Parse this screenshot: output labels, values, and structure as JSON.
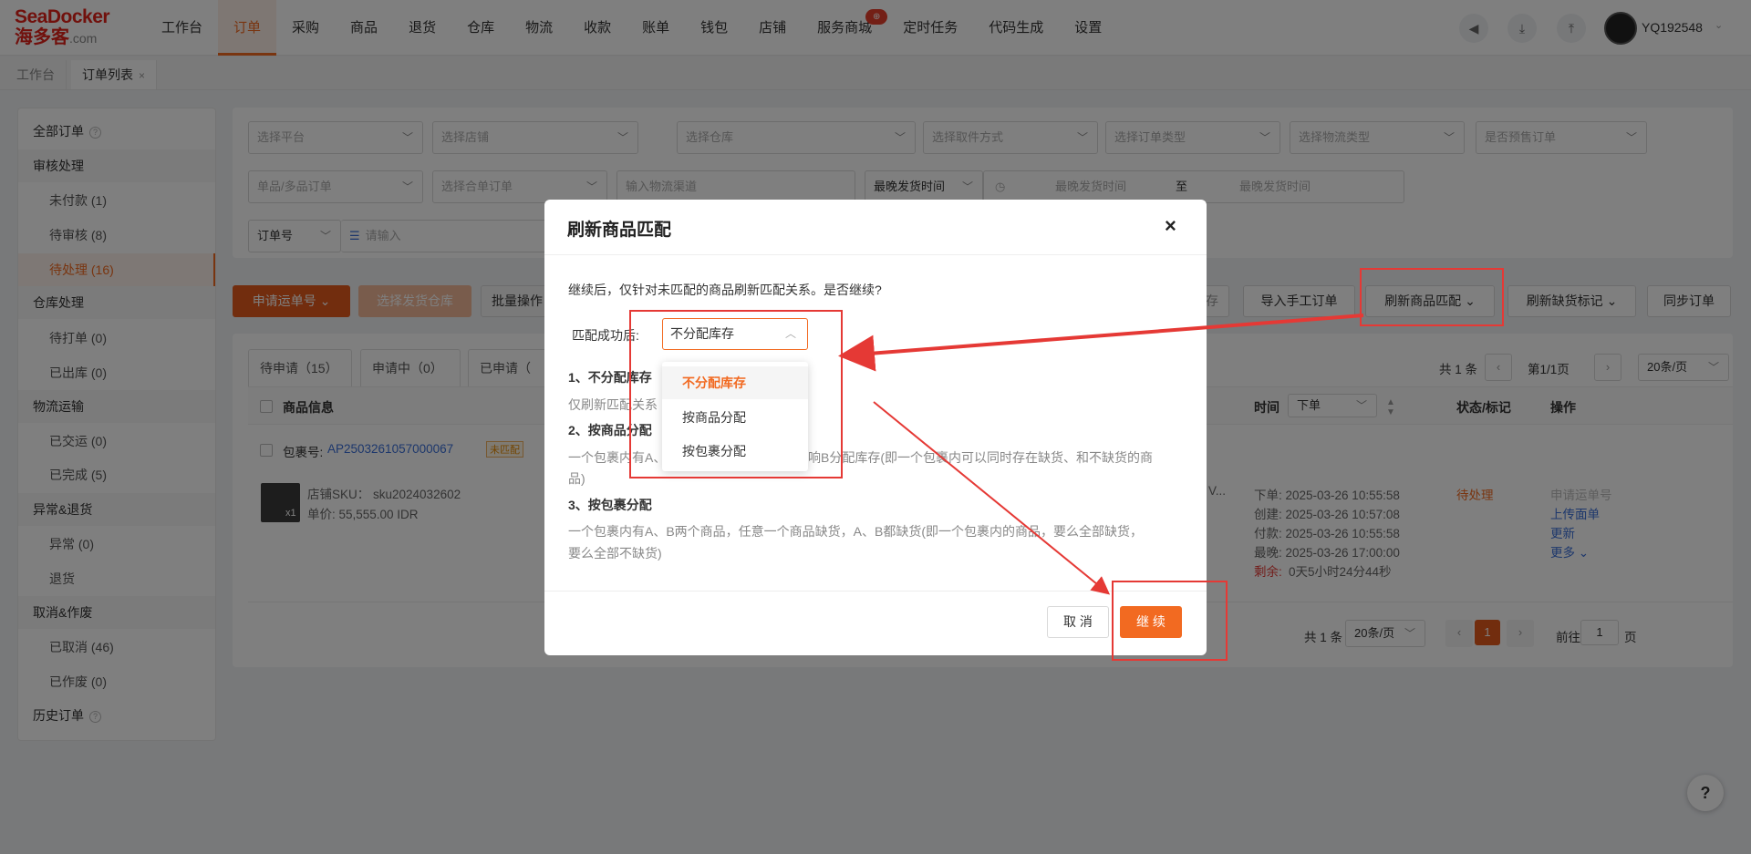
{
  "brand": {
    "line1": "SeaDocker",
    "line2": "海多客",
    "suffix": ".com"
  },
  "nav": [
    {
      "label": "工作台"
    },
    {
      "label": "订单",
      "active": true
    },
    {
      "label": "采购"
    },
    {
      "label": "商品"
    },
    {
      "label": "退货"
    },
    {
      "label": "仓库"
    },
    {
      "label": "物流"
    },
    {
      "label": "收款"
    },
    {
      "label": "账单"
    },
    {
      "label": "钱包"
    },
    {
      "label": "店铺"
    },
    {
      "label": "服务商城",
      "badge": "⊕"
    },
    {
      "label": "定时任务"
    },
    {
      "label": "代码生成"
    },
    {
      "label": "设置"
    }
  ],
  "user": {
    "name": "YQ192548",
    "chev": "⌄"
  },
  "tabs": [
    {
      "label": "工作台"
    },
    {
      "label": "订单列表",
      "close": "×"
    }
  ],
  "sidebar": {
    "all": "全部订单",
    "q": "?",
    "g1": "审核处理",
    "i1": "未付款 (1)",
    "i2": "待审核 (8)",
    "i3": "待处理 (16)",
    "g2": "仓库处理",
    "i4": "待打单 (0)",
    "i5": "已出库 (0)",
    "g3": "物流运输",
    "i6": "已交运 (0)",
    "i7": "已完成 (5)",
    "g4": "异常&退货",
    "i8": "异常 (0)",
    "i9": "退货",
    "g5": "取消&作废",
    "i10": "已取消 (46)",
    "i11": "已作废 (0)",
    "history": "历史订单"
  },
  "filters": {
    "platform": "选择平台",
    "shop": "选择店铺",
    "warehouse": "选择仓库",
    "pickup": "选择取件方式",
    "order_type": "选择订单类型",
    "logistics_type": "选择物流类型",
    "presale": "是否预售订单",
    "single_multi": "单品/多品订单",
    "merge": "选择合单订单",
    "channel": "输入物流渠道",
    "latest_ship": "最晚发货时间",
    "ship_start": "最晚发货时间",
    "to": "至",
    "ship_end": "最晚发货时间",
    "order_no": "订单号",
    "input_ph": "请输入"
  },
  "actions": {
    "apply": "申请运单号 ⌄",
    "select_wh": "选择发货仓库",
    "batch": "批量操作",
    "stock": "存",
    "import": "导入手工订单",
    "refresh_match": "刷新商品匹配 ⌄",
    "refresh_short": "刷新缺货标记 ⌄",
    "sync": "同步订单"
  },
  "status_tabs": [
    {
      "label": "待申请（15）"
    },
    {
      "label": "申请中（0）"
    },
    {
      "label": "已申请（"
    }
  ],
  "table": {
    "col_product": "商品信息",
    "col_time": "时间",
    "time_sel": "下单",
    "col_status": "状态/标记",
    "col_op": "操作",
    "pkg_label": "包裹号:",
    "pkg_no": "AP2503261057000067",
    "pkg_badge": "未匹配",
    "sku": "店铺SKU： sku2024032602",
    "price": "单价: 55,555.00 IDR",
    "qty": "x1",
    "truncated": "V...",
    "times": [
      "下单: 2025-03-26 10:55:58",
      "创建: 2025-03-26 10:57:08",
      "付款: 2025-03-26 10:55:58",
      "最晚: 2025-03-26 17:00:00"
    ],
    "remain_label": "剩余:",
    "remain_val": "0天5小时24分44秒",
    "status": "待处理",
    "ops": [
      "申请运单号",
      "上传面单",
      "更新",
      "更多 ⌄"
    ]
  },
  "pager_top": {
    "total": "共 1 条",
    "page": "第1/1页",
    "size": "20条/页"
  },
  "pager": {
    "total": "共 1 条",
    "size": "20条/页",
    "current": "1",
    "goto": "前往",
    "goto_val": "1",
    "unit": "页"
  },
  "modal": {
    "title": "刷新商品匹配",
    "close": "×",
    "intro": "继续后，仅针对未匹配的商品刷新匹配关系。是否继续?",
    "match_label": "匹配成功后:",
    "match_value": "不分配库存",
    "up": "︿",
    "options": [
      "不分配库存",
      "按商品分配",
      "按包裹分配"
    ],
    "h1": "1、不分配库存",
    "d1": "仅刷新匹配关系",
    "h2": "2、按商品分配",
    "d2a": "一个包裹内有A、",
    "d2b": "响B分配库存(即一个包裹内可以同时存在缺货、和不缺货的商",
    "d2c": "品)",
    "h3": "3、按包裹分配",
    "d3a": "一个包裹内有A、B两个商品，任意一个商品缺货，A、B都缺货(即一个包裹内的商品，要么全部缺货，",
    "d3b": "要么全部不缺货)",
    "cancel": "取 消",
    "continue": "继 续"
  },
  "help": "?"
}
